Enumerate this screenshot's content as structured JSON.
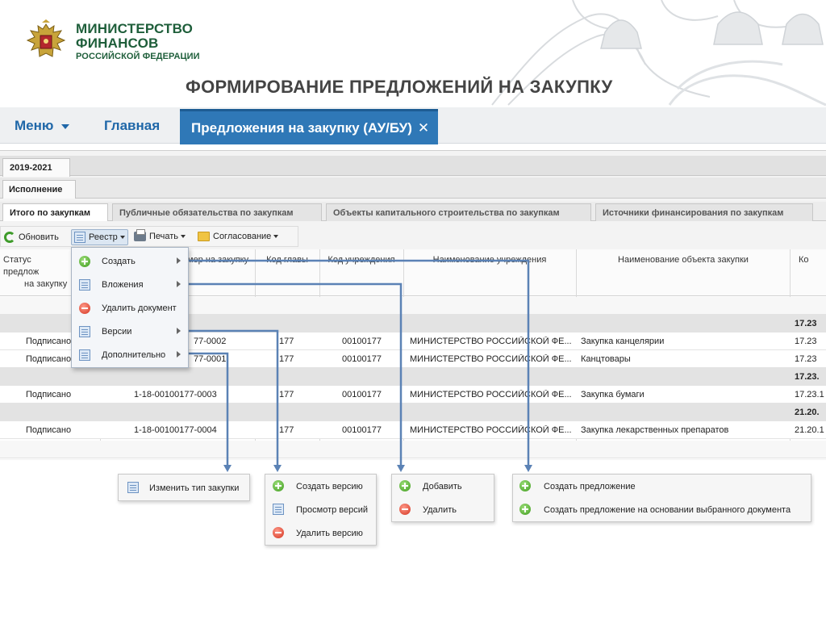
{
  "header": {
    "org_line1": "МИНИСТЕРСТВО",
    "org_line2": "ФИНАНСОВ",
    "org_line3": "РОССИЙСКОЙ ФЕДЕРАЦИИ",
    "page_title": "ФОРМИРОВАНИЕ ПРЕДЛОЖЕНИЙ НА ЗАКУПКУ",
    "emblem_icon": "double-headed-eagle-icon"
  },
  "nav": {
    "menu_label": "Меню",
    "home_label": "Главная",
    "active_tab_label": "Предложения на закупку (АУ/БУ)",
    "close_glyph": "✕"
  },
  "tabs": {
    "year": "2019-2021",
    "execution": "Исполнение",
    "subtabs": [
      "Итого по закупкам",
      "Публичные обязательства по закупкам",
      "Объекты капитального строительства по закупкам",
      "Источники финансирования по закупкам"
    ]
  },
  "toolbar": {
    "refresh": "Обновить",
    "registry": "Реестр",
    "print": "Печать",
    "approval": "Согласование"
  },
  "table": {
    "headers": {
      "status": "Статус предлож",
      "status_line2": "на закупку",
      "number": "мер на закупку",
      "chapter_code": "Код главы",
      "org_code": "Код учреждения",
      "org_name": "Наименование учреждения",
      "object_name": "Наименование объекта закупки",
      "code": "Ко"
    },
    "group_codes": [
      "17.23",
      "17.23.",
      "21.20."
    ],
    "rows": [
      {
        "status": "Подписано",
        "number": "77-0002",
        "chapter": "177",
        "org_code": "00100177",
        "org_name": "МИНИСТЕРСТВО РОССИЙСКОЙ ФЕ...",
        "object": "Закупка канцелярии",
        "code": "17.23"
      },
      {
        "status": "Подписано",
        "number": "77-0001",
        "chapter": "177",
        "org_code": "00100177",
        "org_name": "МИНИСТЕРСТВО РОССИЙСКОЙ ФЕ...",
        "object": "Канцтовары",
        "code": "17.23"
      },
      {
        "status": "Подписано",
        "number": "1-18-00100177-0003",
        "chapter": "177",
        "org_code": "00100177",
        "org_name": "МИНИСТЕРСТВО РОССИЙСКОЙ ФЕ...",
        "object": "Закупка бумаги",
        "code": "17.23.1"
      },
      {
        "status": "Подписано",
        "number": "1-18-00100177-0004",
        "chapter": "177",
        "org_code": "00100177",
        "org_name": "МИНИСТЕРСТВО РОССИЙСКОЙ ФЕ...",
        "object": "Закупка лекарственных препаратов",
        "code": "21.20.1"
      }
    ]
  },
  "registry_menu": {
    "items": [
      "Создать",
      "Вложения",
      "Удалить документ",
      "Версии",
      "Дополнительно"
    ]
  },
  "popups": {
    "extra": [
      "Изменить тип закупки"
    ],
    "versions": [
      "Создать версию",
      "Просмотр версий",
      "Удалить версию"
    ],
    "attachments": [
      "Добавить",
      "Удалить"
    ],
    "create": [
      "Создать предложение",
      "Создать предложение на основании выбранного документа"
    ]
  },
  "colors": {
    "brand_green": "#1e5e3a",
    "nav_blue": "#1f67a8",
    "active_tab": "#2f78b7",
    "connector": "#5b82b5"
  }
}
